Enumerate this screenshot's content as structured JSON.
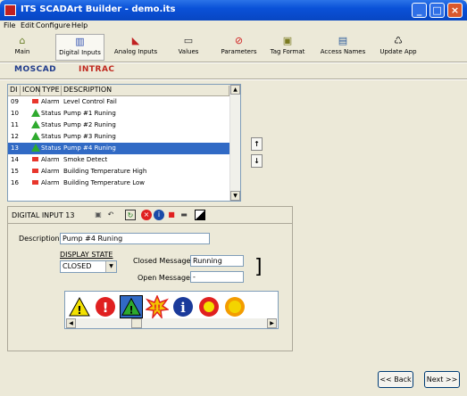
{
  "window": {
    "title": "ITS SCADArt Builder - demo.its"
  },
  "menu": [
    "File",
    "Edit",
    "Configure",
    "Help"
  ],
  "toolbar": {
    "buttons": [
      {
        "label": "Main",
        "icon": "home-icon"
      },
      {
        "label": "Digital Inputs",
        "icon": "digital-inputs-icon",
        "active": true
      },
      {
        "label": "Analog Inputs",
        "icon": "analog-inputs-icon"
      },
      {
        "label": "Values",
        "icon": "values-icon"
      },
      {
        "label": "Parameters",
        "icon": "parameters-icon"
      },
      {
        "label": "Tag Format",
        "icon": "tag-format-icon"
      },
      {
        "label": "Access Names",
        "icon": "access-names-icon"
      },
      {
        "label": "Update App",
        "icon": "update-app-icon"
      }
    ]
  },
  "brands": {
    "moscad": "MOSCAD",
    "intrac": "INTRAC"
  },
  "list": {
    "headers": [
      "DI",
      "ICON",
      "TYPE",
      "DESCRIPTION"
    ],
    "rows": [
      {
        "di": "09",
        "icon": "red-square",
        "type": "Alarm",
        "desc": "Level Control Fail"
      },
      {
        "di": "10",
        "icon": "green-triangle",
        "type": "Status",
        "desc": "Pump #1 Runing"
      },
      {
        "di": "11",
        "icon": "green-triangle",
        "type": "Status",
        "desc": "Pump #2 Runing"
      },
      {
        "di": "12",
        "icon": "green-triangle",
        "type": "Status",
        "desc": "Pump #3 Runing"
      },
      {
        "di": "13",
        "icon": "green-triangle",
        "type": "Status",
        "desc": "Pump #4 Runing",
        "selected": true
      },
      {
        "di": "14",
        "icon": "red-square",
        "type": "Alarm",
        "desc": "Smoke Detect"
      },
      {
        "di": "15",
        "icon": "red-square",
        "type": "Alarm",
        "desc": "Building Temperature High"
      },
      {
        "di": "16",
        "icon": "red-square",
        "type": "Alarm",
        "desc": "Building Temperature Low"
      }
    ]
  },
  "detail": {
    "title": "DIGITAL INPUT 13",
    "description_label": "Description:",
    "description_value": "Pump #4 Runing",
    "display_state_label": "DISPLAY STATE",
    "display_state_value": "CLOSED",
    "closed_label": "Closed Message:",
    "closed_value": "Running",
    "open_label": "Open Message:",
    "open_value": "-"
  },
  "footer": {
    "back": "<< Back",
    "next": "Next >>"
  },
  "colors": {
    "title_blue": "#0a51d8",
    "selection": "#316ac5",
    "moscad": "#1f3b8c",
    "intrac": "#c0281e"
  }
}
